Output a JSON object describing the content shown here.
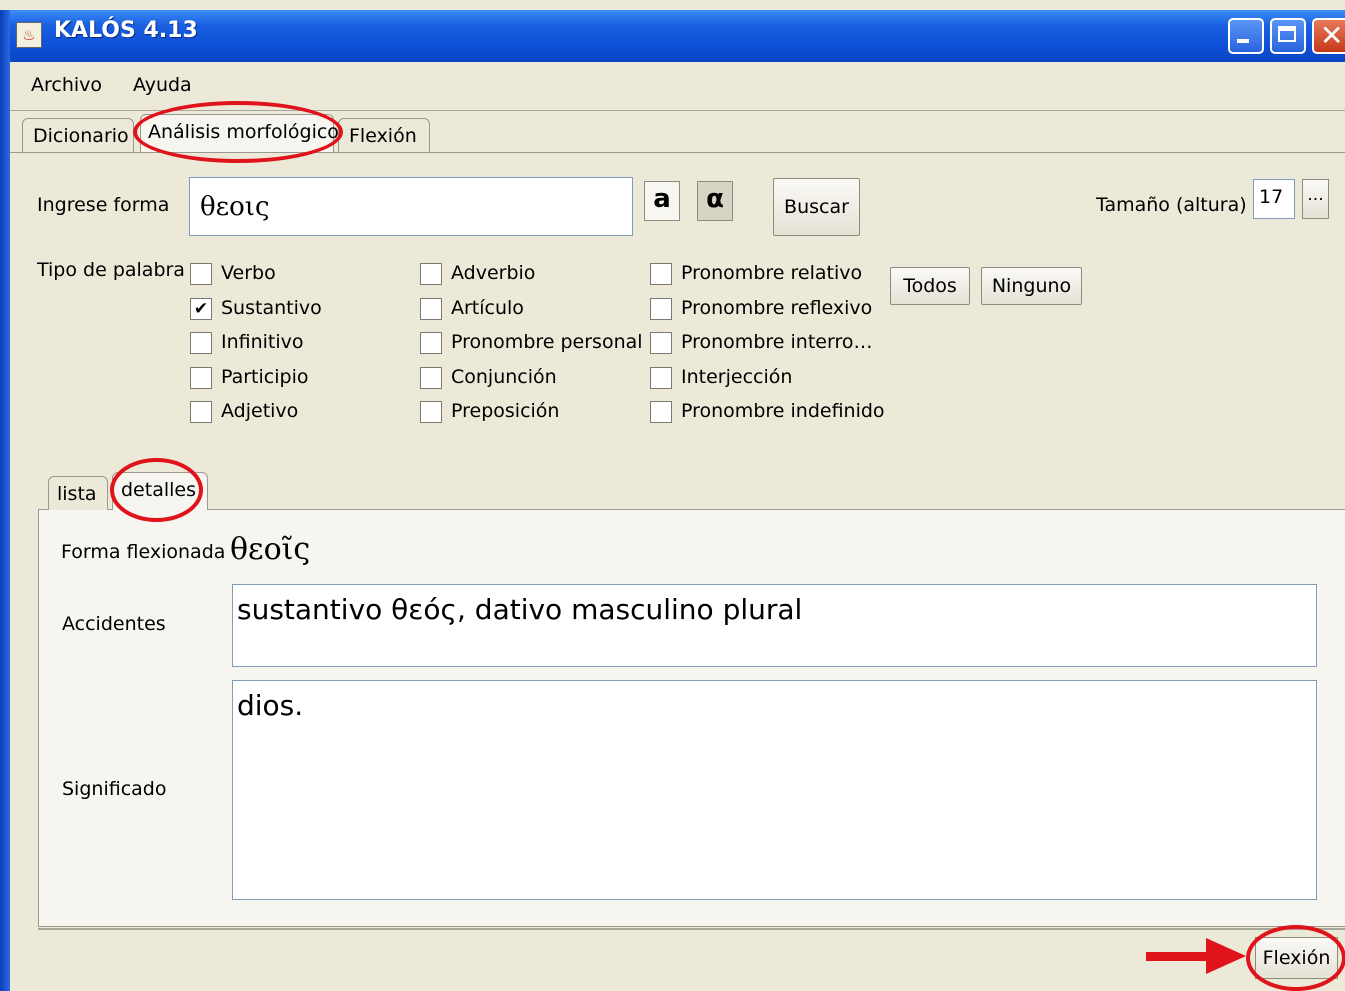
{
  "window": {
    "title": "KALÓS 4.13",
    "titlebar_color": "#0b4fd6",
    "close_color": "#c4391a"
  },
  "menu": [
    "Archivo",
    "Ayuda"
  ],
  "tabs": [
    "Dicionario",
    "Análisis morfológico",
    "Flexión"
  ],
  "search": {
    "label": "Ingrese forma",
    "value": "θεοις",
    "latin_button": "a",
    "greek_button": "α",
    "buscar_button": "Buscar",
    "size_label": "Tamaño (altura)",
    "size_value": "17",
    "size_button": "..."
  },
  "word_type": {
    "label": "Tipo de palabra",
    "options": [
      {
        "label": "Verbo",
        "checked": false
      },
      {
        "label": "Sustantivo",
        "checked": true
      },
      {
        "label": "Infinitivo",
        "checked": false
      },
      {
        "label": "Participio",
        "checked": false
      },
      {
        "label": "Adjetivo",
        "checked": false
      },
      {
        "label": "Adverbio",
        "checked": false
      },
      {
        "label": "Artículo",
        "checked": false
      },
      {
        "label": "Pronombre personal",
        "checked": false
      },
      {
        "label": "Conjunción",
        "checked": false
      },
      {
        "label": "Preposición",
        "checked": false
      },
      {
        "label": "Pronombre relativo",
        "checked": false
      },
      {
        "label": "Pronombre reflexivo",
        "checked": false
      },
      {
        "label": "Pronombre interro…",
        "checked": false
      },
      {
        "label": "Interjección",
        "checked": false
      },
      {
        "label": "Pronombre indefinido",
        "checked": false
      }
    ],
    "todos_button": "Todos",
    "ninguno_button": "Ninguno"
  },
  "inner_tabs": [
    "lista",
    "detalles"
  ],
  "details": {
    "forma_label": "Forma flexionada",
    "forma_value": "θεοῖς",
    "accidentes_label": "Accidentes",
    "accidentes_value": "sustantivo θεός, dativo masculino plural",
    "significado_label": "Significado",
    "significado_value": "dios."
  },
  "flexion_button": "Flexión",
  "annotation_color": "#e0121a"
}
